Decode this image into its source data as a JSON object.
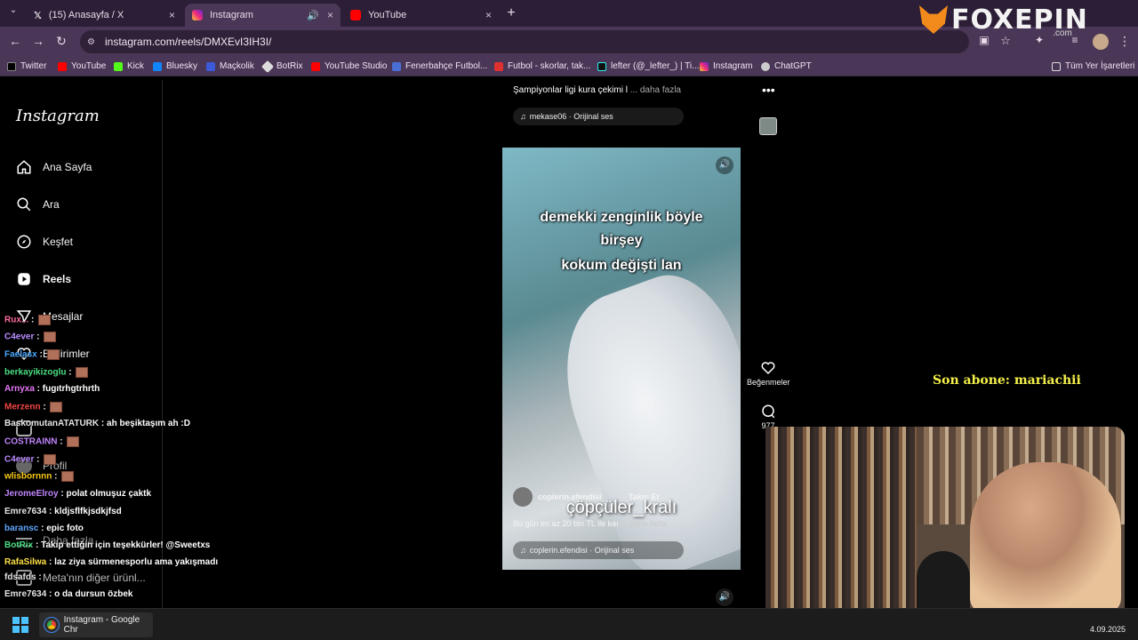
{
  "browser": {
    "tabs": [
      {
        "label": "(15) Anasayfa / X",
        "close": "×"
      },
      {
        "label": "Instagram",
        "close": "×"
      },
      {
        "label": "YouTube",
        "close": "×"
      }
    ],
    "new_tab": "+",
    "url": "instagram.com/reels/DMXEvI3IH3I/",
    "bookmarks": [
      "Twitter",
      "YouTube",
      "Kick",
      "Bluesky",
      "Maçkolik",
      "BotRix",
      "YouTube Studio",
      "Fenerbahçe Futbol...",
      "Futbol - skorlar, tak...",
      "lefter (@_lefter_) | Ti...",
      "Instagram",
      "ChatGPT"
    ],
    "all_bookmarks": "Tüm Yer İşaretleri"
  },
  "logo": {
    "text": "FOXEPIN",
    "suffix": ".com"
  },
  "instagram": {
    "brand": "Instagram",
    "nav": [
      "Ana Sayfa",
      "Ara",
      "Keşfet",
      "Reels",
      "Mesajlar",
      "Bildirimler",
      "Profil",
      "Daha fazla",
      "Meta'nın diğer ürünl..."
    ],
    "top_post": {
      "caption": "Şampiyonlar ligi kura çekimi l",
      "more": "... daha fazla",
      "audio": "mekase06 · Orijinal ses"
    },
    "reel": {
      "caption_lines": [
        "demekki zenginlik böyle",
        "birşey",
        "kokum değişti lan"
      ],
      "overlay_name": "çöpçüler_kralı",
      "user": "coplerin.efendisi",
      "follow": "Takip Et",
      "desc": "Bu gün en az 20 bin TL ile kaı",
      "more": "... daha fazla",
      "audio": "coplerin.efendisi · Orijinal ses"
    },
    "actions": {
      "like_label": "Beğenmeler",
      "comment_count": "977"
    }
  },
  "chat": [
    {
      "user": "Rux...",
      "msg": "",
      "emote": true,
      "color": "#ff6b9d"
    },
    {
      "user": "C4ever",
      "msg": "",
      "emote": true,
      "color": "#b98bff"
    },
    {
      "user": "Faelasx",
      "msg": "",
      "emote": true,
      "color": "#4aa8ff"
    },
    {
      "user": "berkayikizoglu",
      "msg": "",
      "emote": true,
      "color": "#4ade80"
    },
    {
      "user": "Arnyxa",
      "msg": "fugıtrhgtrhrth",
      "emote": false,
      "color": "#e879f9"
    },
    {
      "user": "Merzenn",
      "msg": "",
      "emote": true,
      "color": "#ef4444"
    },
    {
      "user": "BaskomutanATATURK",
      "msg": "ah beşiktaşım ah :D",
      "emote": false,
      "color": "#e5e5e5"
    },
    {
      "user": "COSTRAINN",
      "msg": "",
      "emote": true,
      "color": "#c084fc"
    },
    {
      "user": "C4ever",
      "msg": "",
      "emote": true,
      "color": "#b98bff"
    },
    {
      "user": "wlisbornnn",
      "msg": "",
      "emote": true,
      "color": "#facc15"
    },
    {
      "user": "JeromeElroy",
      "msg": "polat olmuşuz çaktk",
      "emote": false,
      "color": "#c084fc"
    },
    {
      "user": "Emre7634",
      "msg": "kldjsflfkjsdkjfsd",
      "emote": false,
      "color": "#e5e5e5"
    },
    {
      "user": "baransc",
      "msg": "epic foto",
      "emote": false,
      "color": "#60a5fa"
    },
    {
      "user": "BotRix",
      "msg": "Takip ettiğin için teşekkürler! @Sweetxs",
      "emote": false,
      "color": "#4ade80"
    },
    {
      "user": "RafaSilwa",
      "msg": "laz ziya sürmenesporlu ama yakışmadı",
      "emote": false,
      "color": "#fde047"
    },
    {
      "user": "fdsafds",
      "msg": "",
      "emote": false,
      "color": "#e5e5e5"
    },
    {
      "user": "Emre7634",
      "msg": "o da dursun özbek",
      "emote": false,
      "color": "#e5e5e5"
    }
  ],
  "overlay": {
    "last_sub": "Son abone: mariachii"
  },
  "taskbar": {
    "app": "Instagram - Google Chr",
    "date": "4.09.2025"
  },
  "colors": {
    "tabbar": "#2b1e36",
    "toolbar": "#4a3656",
    "sub_text": "#f5f04a"
  }
}
